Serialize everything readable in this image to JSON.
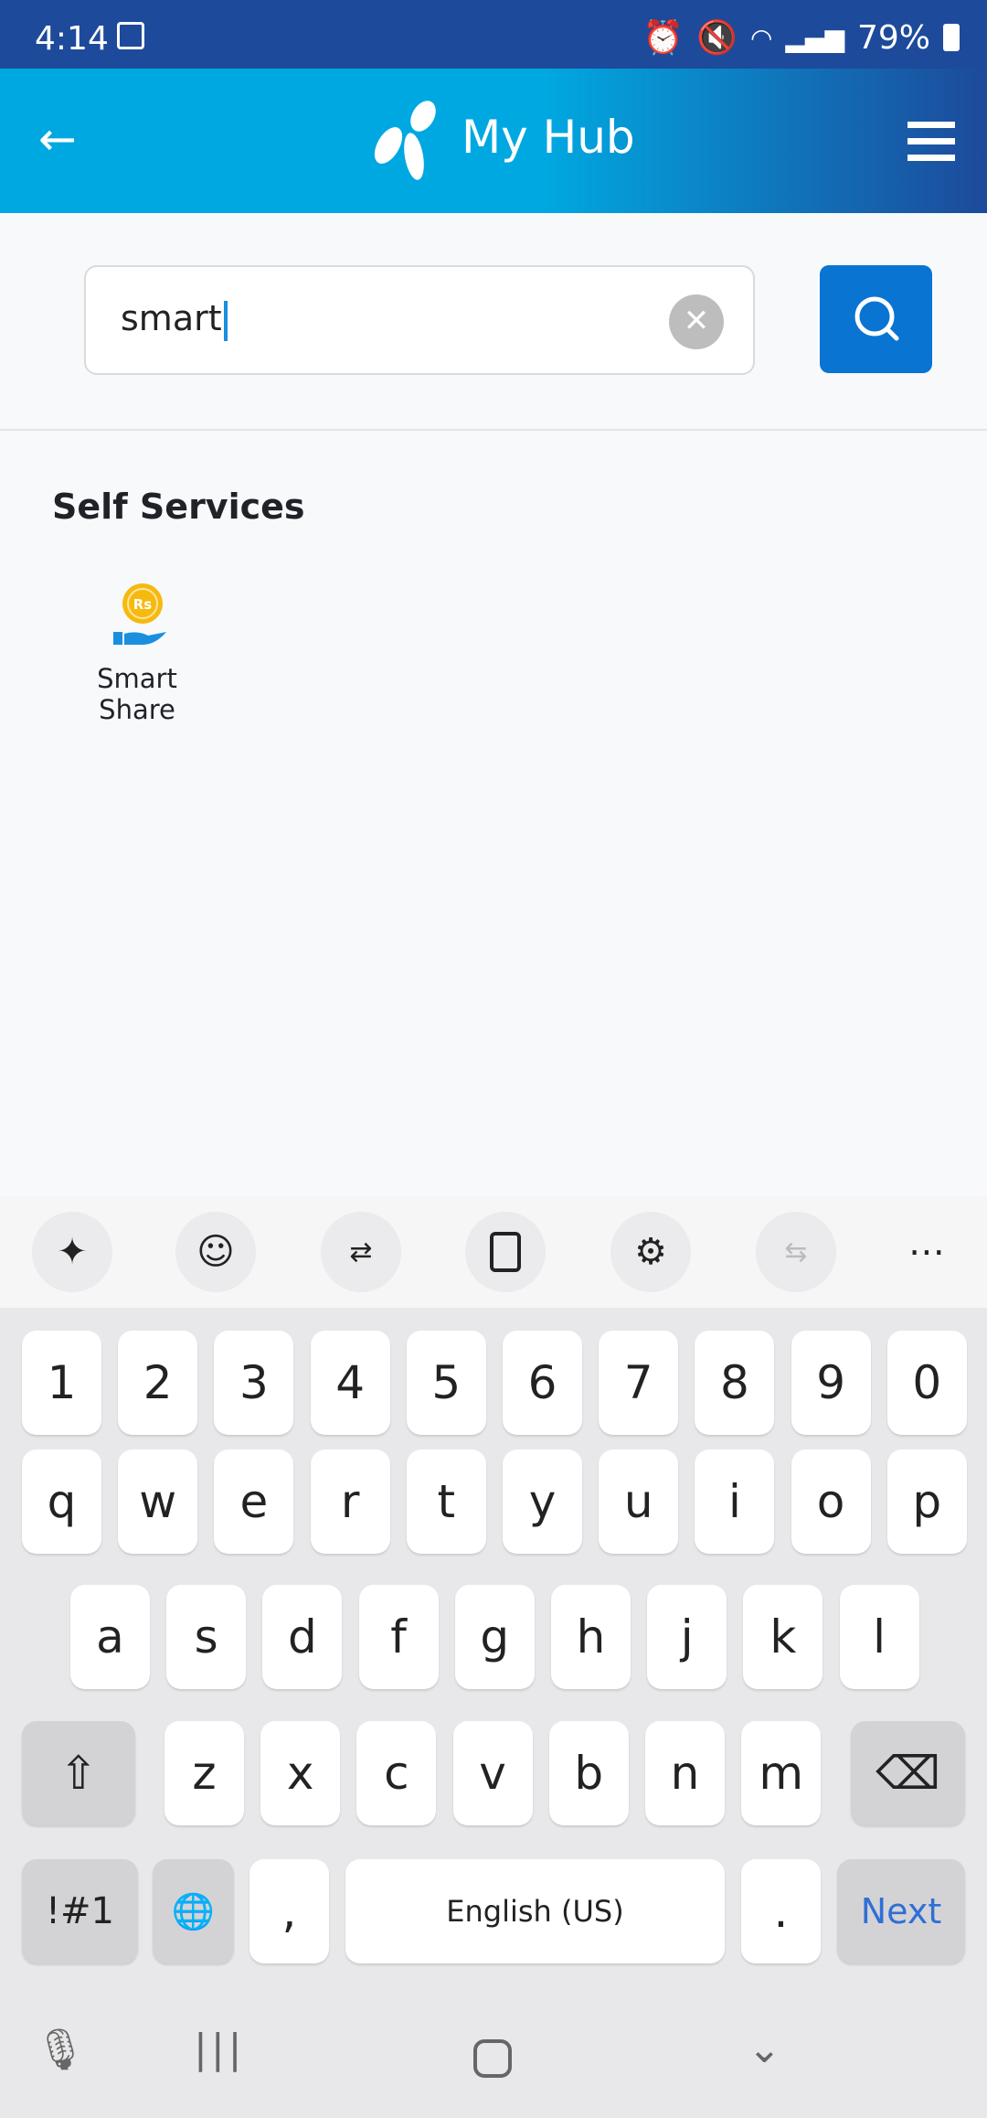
{
  "status_bar": {
    "time": "4:14",
    "battery": "79%",
    "icons": [
      "gallery-icon",
      "alarm-icon",
      "mute-icon",
      "wifi-icon",
      "signal-icon",
      "battery-icon"
    ]
  },
  "header": {
    "title": "My Hub",
    "back_icon": "arrow-left-icon",
    "menu_icon": "hamburger-icon",
    "brand_color": "#00a8e1"
  },
  "search": {
    "value": "smart",
    "clear_icon": "close-icon",
    "button_icon": "search-icon",
    "button_color": "#0a74d2"
  },
  "results": {
    "section_title": "Self Services",
    "items": [
      {
        "label": "Smart Share",
        "icon": "coin-hand-icon",
        "icon_text": "Rs"
      }
    ]
  },
  "keyboard": {
    "toolbar": [
      "sparkle-icon",
      "emoji-icon",
      "translate-icon",
      "clipboard-icon",
      "settings-icon",
      "text-convert-icon",
      "more-icon"
    ],
    "rows": [
      [
        "1",
        "2",
        "3",
        "4",
        "5",
        "6",
        "7",
        "8",
        "9",
        "0"
      ],
      [
        "q",
        "w",
        "e",
        "r",
        "t",
        "y",
        "u",
        "i",
        "o",
        "p"
      ],
      [
        "a",
        "s",
        "d",
        "f",
        "g",
        "h",
        "j",
        "k",
        "l"
      ],
      [
        "z",
        "x",
        "c",
        "v",
        "b",
        "n",
        "m"
      ]
    ],
    "symbols_label": "!#1",
    "comma": ",",
    "space_label": "English (US)",
    "period": ".",
    "action_label": "Next"
  },
  "nav_bar": [
    "mic-icon",
    "recents-icon",
    "home-icon",
    "hide-keyboard-icon"
  ]
}
